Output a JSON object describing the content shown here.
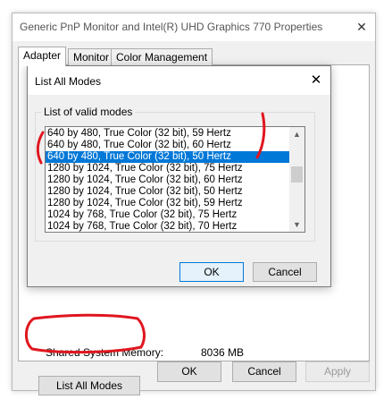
{
  "properties_window": {
    "title": "Generic PnP Monitor and Intel(R) UHD Graphics 770 Properties",
    "tabs": [
      {
        "label": "Adapter",
        "active": true
      },
      {
        "label": "Monitor",
        "active": false
      },
      {
        "label": "Color Management",
        "active": false
      }
    ],
    "shared_memory_label": "Shared System Memory:",
    "shared_memory_value": "8036 MB",
    "list_all_modes_label": "List All Modes",
    "ok_label": "OK",
    "cancel_label": "Cancel",
    "apply_label": "Apply"
  },
  "dialog": {
    "title": "List All Modes",
    "group_label": "List of valid modes",
    "modes": [
      "640 by 480, True Color (32 bit), 59 Hertz",
      "640 by 480, True Color (32 bit), 60 Hertz",
      "640 by 480, True Color (32 bit), 50 Hertz",
      "1280 by 1024, True Color (32 bit), 75 Hertz",
      "1280 by 1024, True Color (32 bit), 60 Hertz",
      "1280 by 1024, True Color (32 bit), 50 Hertz",
      "1280 by 1024, True Color (32 bit), 59 Hertz",
      "1024 by 768, True Color (32 bit), 75 Hertz",
      "1024 by 768, True Color (32 bit), 70 Hertz"
    ],
    "selected_index": 2,
    "ok_label": "OK",
    "cancel_label": "Cancel"
  },
  "colors": {
    "selection": "#0078d7",
    "annotation": "#e0161e"
  },
  "icons": {
    "close": "close-icon",
    "scroll_up": "chevron-up-icon",
    "scroll_down": "chevron-down-icon"
  }
}
